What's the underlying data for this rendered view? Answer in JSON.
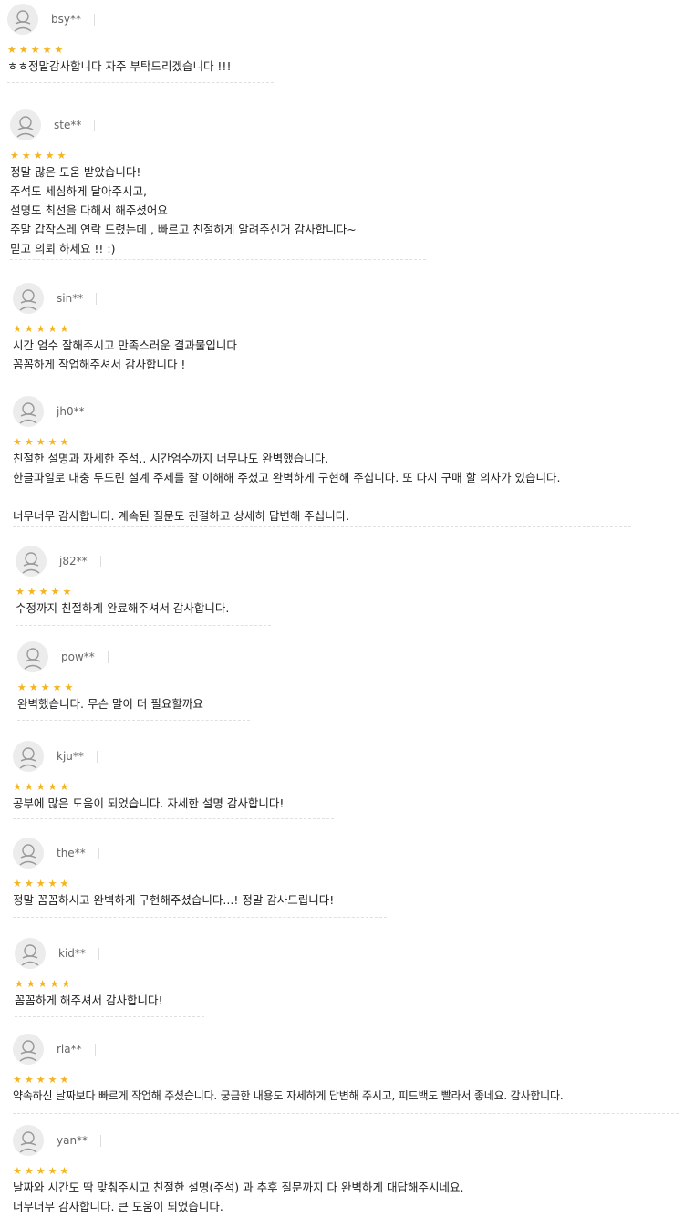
{
  "reviews": [
    {
      "user": "bsy**",
      "stars": "★★★★★",
      "text": "ㅎㅎ정말감사합니다 자주 부탁드리겠습니다 !!!"
    },
    {
      "user": "ste**",
      "stars": "★★★★★",
      "text": "정말 많은 도움 받았습니다!\n주석도 세심하게 달아주시고,\n설명도 최선을 다해서 해주셨어요\n주말 갑작스레 연락 드렸는데 , 빠르고 친절하게 알려주신거 감사합니다~\n믿고 의뢰 하세요 !! :)"
    },
    {
      "user": "sin**",
      "stars": "★★★★★",
      "text": "시간 엄수 잘해주시고 만족스러운 결과물입니다\n꼼꼼하게 작업해주셔서 감사합니다 !"
    },
    {
      "user": "jh0**",
      "stars": "★★★★★",
      "text": "친절한 설명과 자세한 주석.. 시간엄수까지 너무나도 완벽했습니다.\n한글파일로 대충 두드린 설계 주제를 잘 이해해 주셨고 완벽하게 구현해 주십니다. 또 다시 구매 할 의사가 있습니다.\n\n너무너무 감사합니다. 계속된 질문도 친절하고 상세히 답변해 주십니다."
    },
    {
      "user": "j82**",
      "stars": "★★★★★",
      "text": "수정까지 친절하게 완료해주셔서 감사합니다."
    },
    {
      "user": "pow**",
      "stars": "★★★★★",
      "text": "완벽했습니다. 무슨 말이 더 필요할까요"
    },
    {
      "user": "kju**",
      "stars": "★★★★★",
      "text": "공부에 많은 도움이 되었습니다. 자세한 설명 감사합니다!"
    },
    {
      "user": "the**",
      "stars": "★★★★★",
      "text": "정말 꼼꼼하시고 완벽하게 구현해주셨습니다...! 정말 감사드립니다!"
    },
    {
      "user": "kid**",
      "stars": "★★★★★",
      "text": "꼼꼼하게 해주셔서 감사합니다!"
    },
    {
      "user": "rla**",
      "stars": "★★★★★",
      "text": "약속하신 날짜보다 빠르게 작업해 주셨습니다. 궁금한 내용도 자세하게 답변해 주시고, 피드백도 빨라서 좋네요. 감사합니다."
    },
    {
      "user": "yan**",
      "stars": "★★★★★",
      "text": "날짜와 시간도 딱 맞춰주시고 친절한 설명(주석) 과 추후 질문까지 다 완벽하게 대답해주시네요.\n너무너무 감사합니다. 큰 도움이 되었습니다."
    }
  ]
}
